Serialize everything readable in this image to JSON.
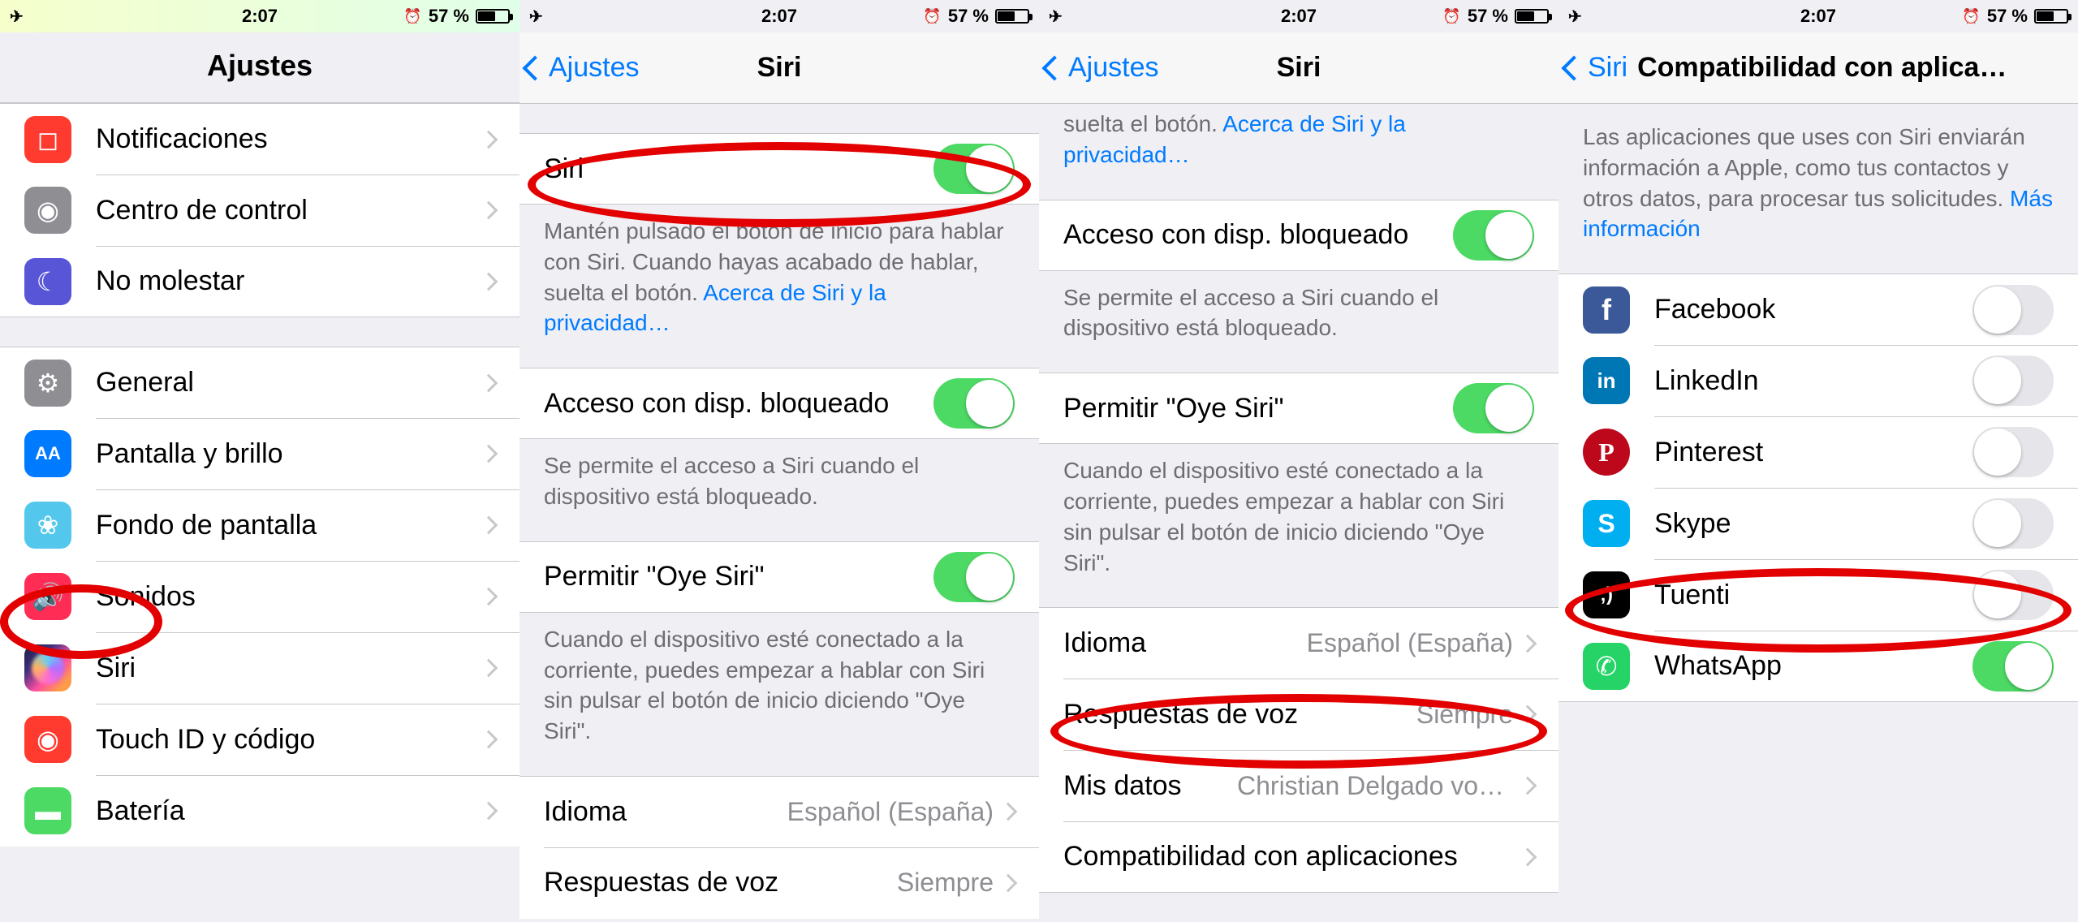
{
  "status": {
    "time": "2:07",
    "battery_text": "57 %",
    "airplane": "✈︎",
    "alarm": "⏰"
  },
  "screen1": {
    "title": "Ajustes",
    "group1": [
      {
        "icon": "notif",
        "glyph": "◻︎",
        "label": "Notificaciones"
      },
      {
        "icon": "cc",
        "glyph": "◉",
        "label": "Centro de control"
      },
      {
        "icon": "dnd",
        "glyph": "☾",
        "label": "No molestar"
      }
    ],
    "group2": [
      {
        "icon": "general",
        "glyph": "⚙︎",
        "label": "General"
      },
      {
        "icon": "display",
        "glyph": "AA",
        "label": "Pantalla y brillo"
      },
      {
        "icon": "wall",
        "glyph": "❀",
        "label": "Fondo de pantalla"
      },
      {
        "icon": "sound",
        "glyph": "🔊",
        "label": "Sonidos"
      },
      {
        "icon": "siri",
        "glyph": "",
        "label": "Siri"
      },
      {
        "icon": "touchid",
        "glyph": "◉",
        "label": "Touch ID y código"
      },
      {
        "icon": "battery",
        "glyph": "▬",
        "label": "Batería"
      }
    ]
  },
  "screen2": {
    "back": "Ajustes",
    "title": "Siri",
    "rows": {
      "siri_toggle": "Siri",
      "siri_footer_a": "Mantén pulsado el botón de inicio para hablar con Siri. Cuando hayas acabado de hablar, suelta el botón. ",
      "siri_footer_link": "Acerca de Siri y la privacidad…",
      "access_locked": "Acceso con disp. bloqueado",
      "access_footer": "Se permite el acceso a Siri cuando el dispositivo está bloqueado.",
      "hey_siri": "Permitir \"Oye Siri\"",
      "hey_footer": "Cuando el dispositivo esté conectado a la corriente, puedes empezar a hablar con Siri sin pulsar el botón de inicio diciendo \"Oye Siri\".",
      "language": "Idioma",
      "language_val": "Español (España)",
      "voice_resp": "Respuestas de voz",
      "voice_resp_val": "Siempre"
    }
  },
  "screen3": {
    "back": "Ajustes",
    "title": "Siri",
    "rows": {
      "siri_footer_a_tail": "suelta el botón. ",
      "siri_footer_link": "Acerca de Siri y la privacidad…",
      "access_locked": "Acceso con disp. bloqueado",
      "access_footer": "Se permite el acceso a Siri cuando el dispositivo está bloqueado.",
      "hey_siri": "Permitir \"Oye Siri\"",
      "hey_footer": "Cuando el dispositivo esté conectado a la corriente, puedes empezar a hablar con Siri sin pulsar el botón de inicio diciendo \"Oye Siri\".",
      "language": "Idioma",
      "language_val": "Español (España)",
      "voice_resp": "Respuestas de voz",
      "voice_resp_val": "Siempre",
      "my_info": "Mis datos",
      "my_info_val": "Christian Delgado von…",
      "app_support": "Compatibilidad con aplicaciones"
    }
  },
  "screen4": {
    "back": "Siri",
    "title": "Compatibilidad con aplicacio…",
    "header_text": "Las aplicaciones que uses con Siri enviarán información a Apple, como tus contactos y otros datos, para procesar tus solicitudes. ",
    "header_link": "Más información",
    "apps": [
      {
        "icon": "fb",
        "glyph": "f",
        "label": "Facebook",
        "on": false
      },
      {
        "icon": "li",
        "glyph": "in",
        "label": "LinkedIn",
        "on": false
      },
      {
        "icon": "pin",
        "glyph": "P",
        "label": "Pinterest",
        "on": false
      },
      {
        "icon": "skype",
        "glyph": "S",
        "label": "Skype",
        "on": false
      },
      {
        "icon": "tuenti",
        "glyph": ";)",
        "label": "Tuenti",
        "on": false
      },
      {
        "icon": "wa",
        "glyph": "✆",
        "label": "WhatsApp",
        "on": true
      }
    ]
  }
}
